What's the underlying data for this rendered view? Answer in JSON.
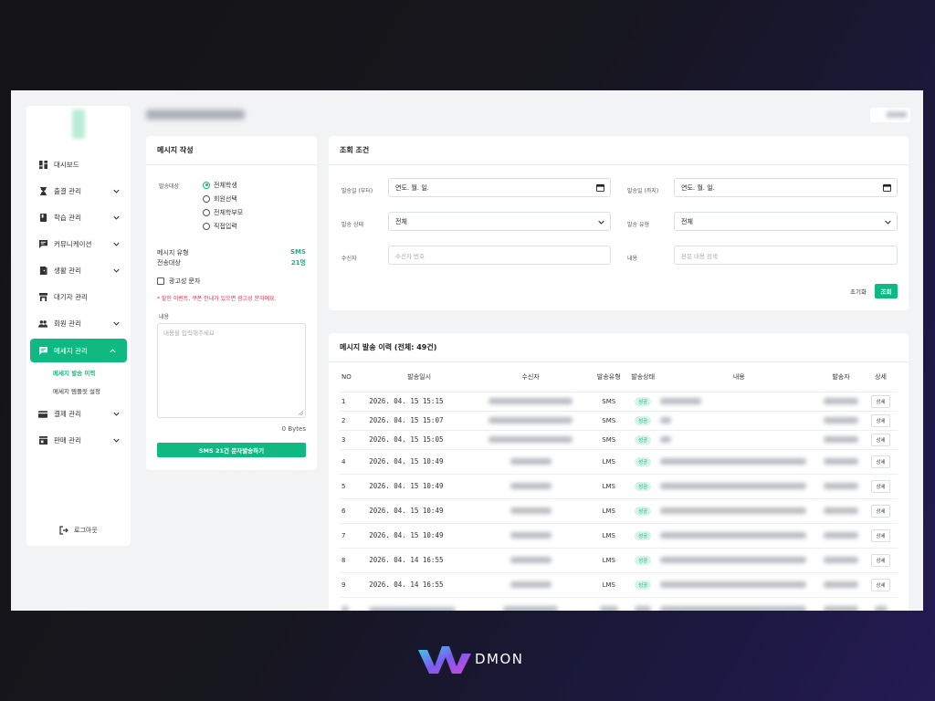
{
  "sidebar": {
    "items": [
      {
        "label": "대시보드",
        "icon": "dashboard-icon",
        "chevron": false
      },
      {
        "label": "출결 관리",
        "icon": "hourglass-icon",
        "chevron": true
      },
      {
        "label": "학습 관리",
        "icon": "book-icon",
        "chevron": true
      },
      {
        "label": "커뮤니케이션",
        "icon": "chat-icon",
        "chevron": true
      },
      {
        "label": "생활 관리",
        "icon": "door-icon",
        "chevron": true
      },
      {
        "label": "대기자 관리",
        "icon": "store-icon",
        "chevron": false
      },
      {
        "label": "회원 관리",
        "icon": "people-icon",
        "chevron": true
      },
      {
        "label": "메세지 관리",
        "icon": "message-icon",
        "chevron": true,
        "active": true
      },
      {
        "label": "결제 관리",
        "icon": "card-icon",
        "chevron": true
      },
      {
        "label": "판매 관리",
        "icon": "shop-icon",
        "chevron": true
      }
    ],
    "subitems": [
      "메세지 발송 이력",
      "메세지 템플릿 설정"
    ],
    "logout": "로그아웃"
  },
  "compose": {
    "title": "메시지 작성",
    "target_label": "발송대상",
    "radios": [
      "전체학생",
      "회원선택",
      "전체학부모",
      "직접입력"
    ],
    "msg_type_label": "메시지 유형",
    "msg_type_value": "SMS",
    "recipients_label": "전송대상",
    "recipients_value": "21명",
    "ad_checkbox": "광고성 문자",
    "warning": "* 할인 이벤트, 쿠폰 안내가 있으면 광고성 문자예요.",
    "content_label": "내용",
    "content_placeholder": "내용을 입력해주세요",
    "bytes": "0 Bytes",
    "send_button": "SMS 21건 문자발송하기"
  },
  "search": {
    "title": "조회 조건",
    "from_label": "발송일 (부터)",
    "from_value": "연도. 월. 일.",
    "to_label": "발송일 (까지)",
    "to_value": "연도. 월. 일.",
    "status_label": "발송 상태",
    "status_value": "전체",
    "type_label": "발송 유형",
    "type_value": "전체",
    "receiver_label": "수신자",
    "receiver_placeholder": "수신자 번호",
    "content_label": "내용",
    "content_placeholder": "본문 내용 검색",
    "reset_button": "초기화",
    "query_button": "조회"
  },
  "history": {
    "title": "메시지 발송 이력 (전체: 49건)",
    "columns": [
      "NO",
      "발송일시",
      "수신자",
      "발송유형",
      "발송상태",
      "내용",
      "발송자",
      "상세"
    ],
    "rows": [
      {
        "no": "1",
        "time": "2026. 04. 15 15:15",
        "type": "SMS",
        "status": "성공",
        "detail": "상세"
      },
      {
        "no": "2",
        "time": "2026. 04. 15 15:07",
        "type": "SMS",
        "status": "성공",
        "detail": "상세"
      },
      {
        "no": "3",
        "time": "2026. 04. 15 15:05",
        "type": "SMS",
        "status": "성공",
        "detail": "상세"
      },
      {
        "no": "4",
        "time": "2026. 04. 15 10:49",
        "type": "LMS",
        "status": "성공",
        "detail": "상세"
      },
      {
        "no": "5",
        "time": "2026. 04. 15 10:49",
        "type": "LMS",
        "status": "성공",
        "detail": "상세"
      },
      {
        "no": "6",
        "time": "2026. 04. 15 10:49",
        "type": "LMS",
        "status": "성공",
        "detail": "상세"
      },
      {
        "no": "7",
        "time": "2026. 04. 15 10:49",
        "type": "LMS",
        "status": "성공",
        "detail": "상세"
      },
      {
        "no": "8",
        "time": "2026. 04. 14 16:55",
        "type": "LMS",
        "status": "성공",
        "detail": "상세"
      },
      {
        "no": "9",
        "time": "2026. 04. 14 16:55",
        "type": "LMS",
        "status": "성공",
        "detail": "상세"
      }
    ]
  },
  "brand": {
    "name": "DMON"
  },
  "colors": {
    "accent": "#10b981",
    "warning": "#e0364a",
    "badge_bg": "#d6f5e8"
  }
}
